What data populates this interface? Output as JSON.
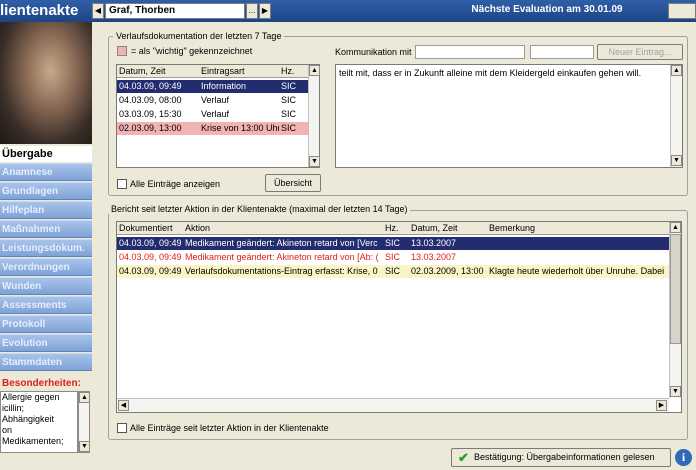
{
  "app": {
    "title": "lientenakte",
    "evaluation": "Nächste Evaluation am 30.01.09",
    "patient": "Graf, Thorben",
    "nav_prev": "◀",
    "nav_next": "▶",
    "patient_dd": "..."
  },
  "sidebar": {
    "active": "Übergabe",
    "items": [
      "Anamnese",
      "Grundlagen",
      "Hilfeplan",
      "Maßnahmen",
      "Leistungsdokum.",
      "Verordnungen",
      "Wunden",
      "Assessments",
      "Protokoll",
      "Evolution",
      "Stammdaten"
    ],
    "besonderheiten_label": "Besonderheiten:",
    "besonderheiten_text": "Allergie gegen\nicillin;\nAbhängigkeit\non\nMedikamenten;"
  },
  "verlauf": {
    "legend": "Verlaufsdokumentation der letzten 7 Tage",
    "wichtig_label": "= als \"wichtig\" gekennzeichnet",
    "columns": [
      "Datum, Zeit",
      "Eintragsart",
      "Hz."
    ],
    "rows": [
      {
        "datum": "04.03.09, 09:49",
        "art": "Information",
        "hz": "SIC",
        "style": "sel"
      },
      {
        "datum": "04.03.09, 08:00",
        "art": "Verlauf",
        "hz": "SIC",
        "style": ""
      },
      {
        "datum": "03.03.09, 15:30",
        "art": "Verlauf",
        "hz": "SIC",
        "style": ""
      },
      {
        "datum": "02.03.09, 13:00",
        "art": "Krise von 13:00 Uhr",
        "hz": "SIC",
        "style": "red"
      }
    ],
    "alle_label": "Alle Einträge anzeigen",
    "uebersicht": "Übersicht",
    "kommunikation_label": "Kommunikation mit",
    "neuer_eintrag": "Neuer Eintrag...",
    "text": "teilt mit, dass er in Zukunft alleine mit dem Kleidergeld einkaufen gehen will."
  },
  "bericht": {
    "legend": "Bericht seit letzter Aktion in der Klientenakte (maximal der letzten 14 Tage)",
    "columns": [
      "Dokumentiert",
      "Aktion",
      "Hz.",
      "Datum, Zeit",
      "Bemerkung"
    ],
    "rows": [
      {
        "dok": "04.03.09, 09:49",
        "aktion": "Medikament geändert: Akineton retard von [Verc",
        "hz": "SIC",
        "datum": "13.03.2007",
        "bem": "",
        "style": "sel"
      },
      {
        "dok": "04.03.09, 09:49",
        "aktion": "Medikament geändert: Akineton retard von [Ab: (",
        "hz": "SIC",
        "datum": "13.03.2007",
        "bem": "",
        "style": "redtext"
      },
      {
        "dok": "04.03.09, 09:49",
        "aktion": "Verlaufsdokumentations-Eintrag erfasst: Krise, 0",
        "hz": "SIC",
        "datum": "02.03.2009, 13:00",
        "bem": "Klagte heute wiederholt über Unruhe. Dabei k",
        "style": "yel"
      }
    ],
    "alle_label": "Alle Einträge seit letzter Aktion in der Klientenakte"
  },
  "footer": {
    "confirm": "Bestätigung: Übergabeinformationen gelesen",
    "info": "i"
  },
  "colors": {
    "accent": "#1d4585",
    "selected": "#232c6e",
    "important": "#f3b3b3",
    "highlight": "#fbf4c6",
    "alert": "#e0201a"
  }
}
